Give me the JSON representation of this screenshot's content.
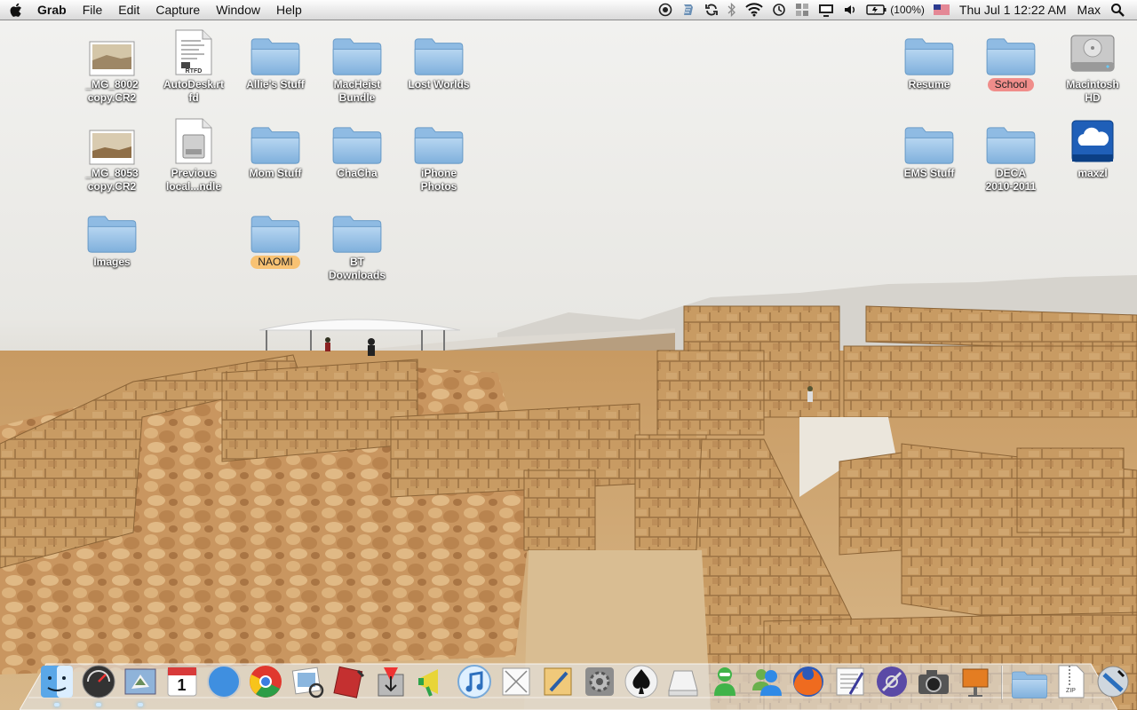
{
  "menubar": {
    "apple_icon": "apple-logo-icon",
    "app_name": "Grab",
    "menus": [
      "File",
      "Edit",
      "Capture",
      "Window",
      "Help"
    ],
    "status_icons": [
      "camera-icon",
      "scripts-icon",
      "sync-icon",
      "bluetooth-icon",
      "wifi-icon",
      "time-machine-icon",
      "spaces-icon",
      "display-icon",
      "volume-icon",
      "battery-icon"
    ],
    "battery_percent": "(100%)",
    "input_flag": "us-flag-icon",
    "clock": "Thu Jul 1  12:22 AM",
    "user": "Max",
    "spotlight_icon": "spotlight-icon"
  },
  "desktop": {
    "icons": [
      {
        "label": "_MG_8002\ncopy.CR2",
        "type": "photo"
      },
      {
        "label": "AutoDesk.rt\nfd",
        "type": "document"
      },
      {
        "label": "Allie's Stuff",
        "type": "folder"
      },
      {
        "label": "MacHeist\nBundle",
        "type": "folder"
      },
      {
        "label": "Lost Worlds",
        "type": "folder"
      },
      {
        "label": "_MG_8053\ncopy.CR2",
        "type": "photo"
      },
      {
        "label": "Previous\nlocal...ndle",
        "type": "disk-image"
      },
      {
        "label": "Mom Stuff",
        "type": "folder"
      },
      {
        "label": "ChaCha",
        "type": "folder"
      },
      {
        "label": "iPhone\nPhotos",
        "type": "folder"
      },
      {
        "label": "Images",
        "type": "folder"
      },
      {
        "label": "NAOMI",
        "type": "folder",
        "tag": "orange"
      },
      {
        "label": "BT\nDownloads",
        "type": "folder"
      },
      {
        "label": "Resume",
        "type": "folder"
      },
      {
        "label": "School",
        "type": "folder",
        "tag": "red"
      },
      {
        "label": "Macintosh\nHD",
        "type": "hard-drive"
      },
      {
        "label": "EMS Stuff",
        "type": "folder"
      },
      {
        "label": "DECA\n2010-2011",
        "type": "folder"
      },
      {
        "label": "maxzl",
        "type": "idisk"
      }
    ],
    "calendar_day": "1",
    "zip_text": "ZIP",
    "rtfd_text": "RTFD"
  },
  "dock": {
    "apps": [
      "finder-icon",
      "dashboard-icon",
      "mail-icon",
      "ical-icon",
      "safari-icon",
      "chrome-icon",
      "preview-icon",
      "textbook-icon",
      "installer-icon",
      "megaphone-icon",
      "itunes-icon",
      "text-edit-icon",
      "pages-icon",
      "system-preferences-icon",
      "spades-icon",
      "drive-icon",
      "chat-icon",
      "messenger-icon",
      "firefox-icon",
      "script-editor-icon",
      "tweak-icon",
      "camera-icon",
      "keynote-icon"
    ],
    "stacks": [
      "folder-stack-icon",
      "zip-stack-icon",
      "download-stack-icon",
      "trash-icon"
    ]
  }
}
